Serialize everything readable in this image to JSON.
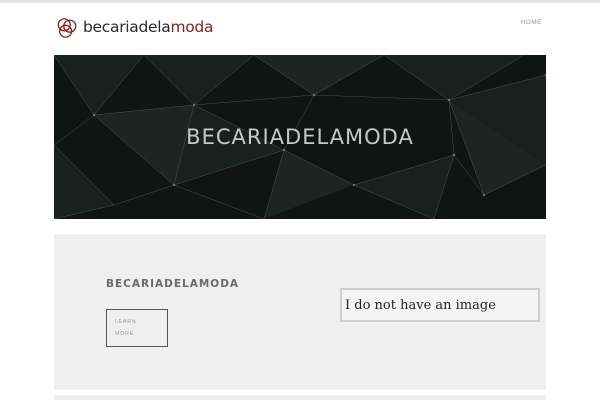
{
  "header": {
    "logo_text_main": "becariadela",
    "logo_text_accent": "moda",
    "logo_alt": "becariadelamoda",
    "nav": {
      "home_label": "HOME"
    }
  },
  "hero": {
    "title": "BECARIADELAMODA"
  },
  "feature": {
    "title": "BECARIADELAMODA",
    "button": {
      "line1": "LEARN",
      "line2": "MORE"
    },
    "image_placeholder": "I do not have an image"
  },
  "colors": {
    "logo_accent": "#8b1d16",
    "hero_background": "#101413",
    "feature_background": "#efefef"
  }
}
